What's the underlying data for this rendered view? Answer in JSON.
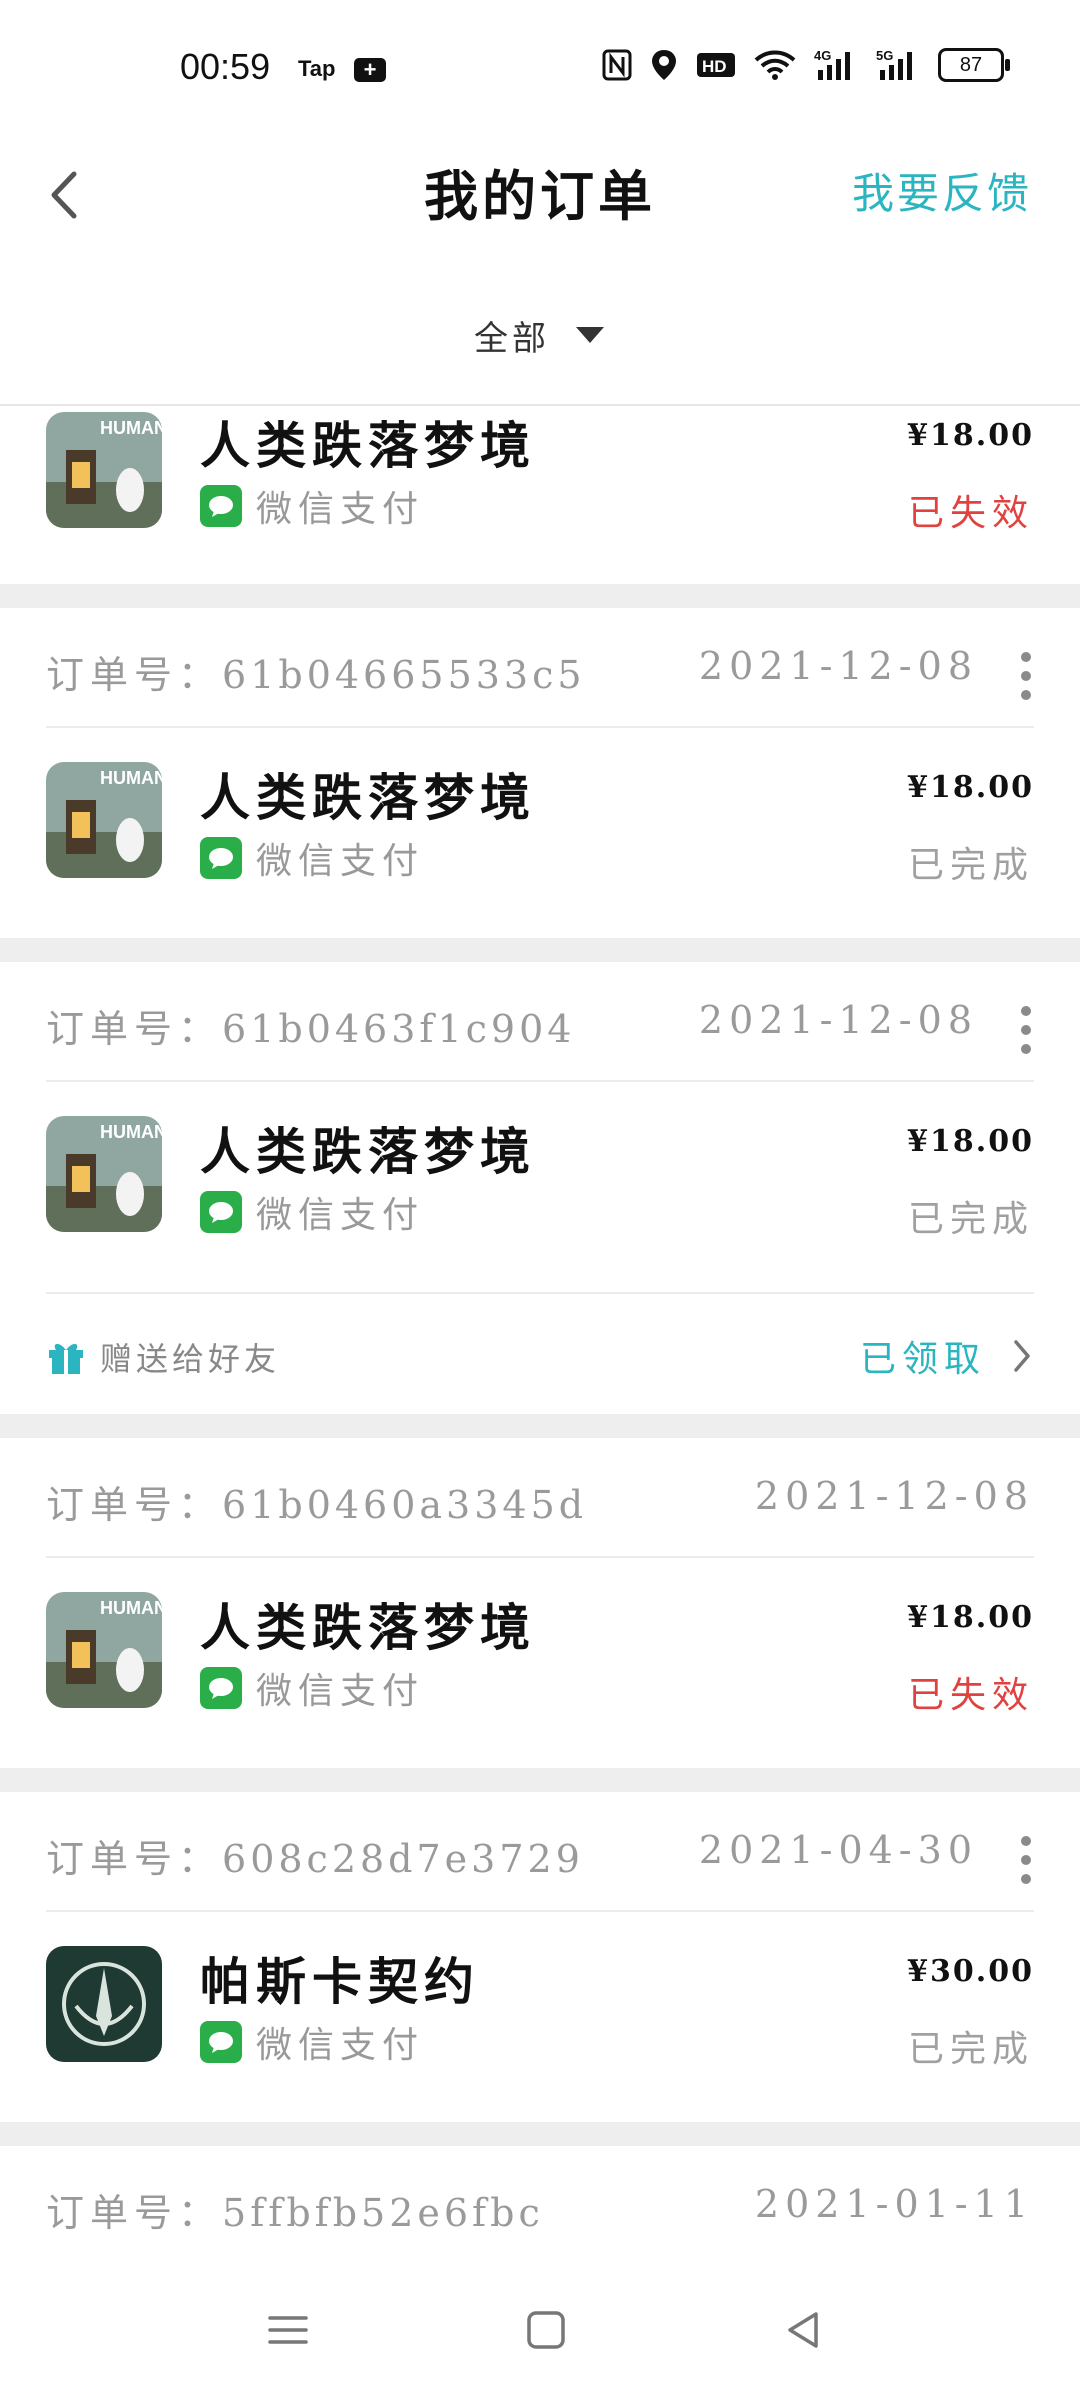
{
  "status_bar": {
    "time": "00:59",
    "tap": "Tap",
    "plus": "+",
    "battery": "87",
    "icons": [
      "nfc-icon",
      "location-icon",
      "hd-icon",
      "wifi-icon",
      "signal-4g-icon",
      "signal-5g-icon",
      "battery-icon"
    ],
    "signal_4g": "4G",
    "signal_5g": "5G",
    "hd": "HD"
  },
  "header": {
    "title": "我的订单",
    "feedback": "我要反馈"
  },
  "filter": {
    "selected": "全部"
  },
  "colors": {
    "accent": "#2bb5c0",
    "fail": "#e0433f",
    "wechat": "#2aae4a"
  },
  "orders": [
    {
      "item": {
        "name": "人类跌落梦境",
        "pay": "微信支付",
        "price": "¥18.00",
        "status": "已失效"
      }
    },
    {
      "label": "订单号：",
      "id": "61b04665533c5",
      "date": "2021-12-08",
      "item": {
        "name": "人类跌落梦境",
        "pay": "微信支付",
        "price": "¥18.00",
        "status": "已完成"
      }
    },
    {
      "label": "订单号：",
      "id": "61b0463f1c904",
      "date": "2021-12-08",
      "item": {
        "name": "人类跌落梦境",
        "pay": "微信支付",
        "price": "¥18.00",
        "status": "已完成"
      },
      "gift": {
        "text": "赠送给好友",
        "status": "已领取"
      }
    },
    {
      "label": "订单号：",
      "id": "61b0460a3345d",
      "date": "2021-12-08",
      "item": {
        "name": "人类跌落梦境",
        "pay": "微信支付",
        "price": "¥18.00",
        "status": "已失效"
      }
    },
    {
      "label": "订单号：",
      "id": "608c28d7e3729",
      "date": "2021-04-30",
      "item": {
        "name": "帕斯卡契约",
        "pay": "微信支付",
        "price": "¥30.00",
        "status": "已完成"
      }
    },
    {
      "label": "订单号：",
      "id": "5ffbfb52e6fbc",
      "date": "2021-01-11"
    }
  ]
}
